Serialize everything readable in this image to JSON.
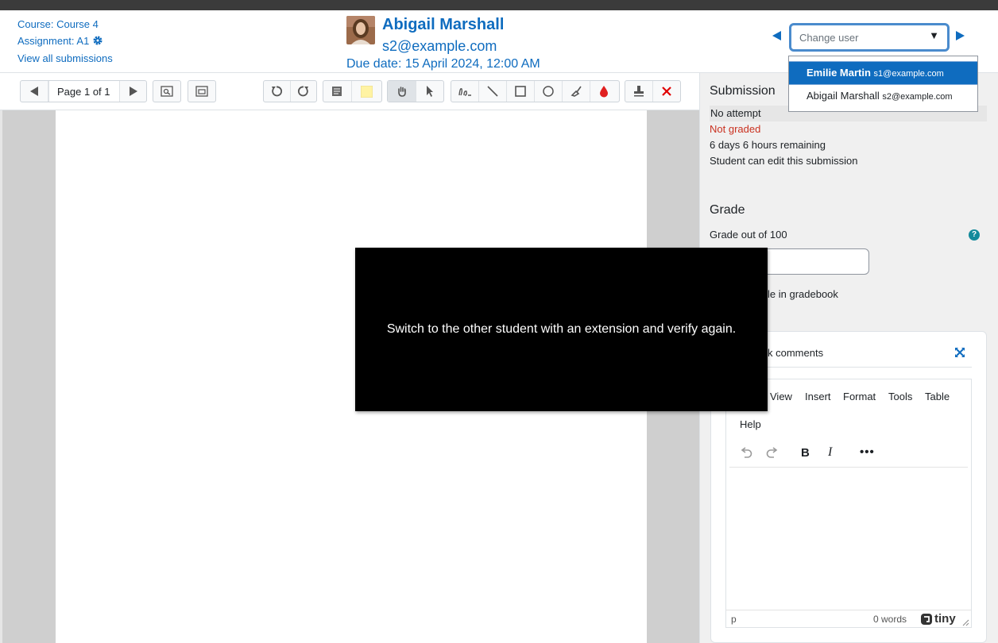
{
  "header": {
    "course": "Course: Course 4",
    "assignment": "Assignment: A1",
    "view_all": "View all submissions",
    "user_name": "Abigail Marshall",
    "user_email": "s2@example.com",
    "due_date": "Due date: 15 April 2024, 12:00 AM"
  },
  "user_switcher": {
    "placeholder": "Change user",
    "options": [
      {
        "name": "Emilie Martin",
        "email": "s1@example.com",
        "selected": true
      },
      {
        "name": "Abigail Marshall",
        "email": "s2@example.com",
        "selected": false
      }
    ]
  },
  "toolbar": {
    "page_label": "Page 1 of 1",
    "icons": [
      "prev-page-icon",
      "next-page-icon",
      "search-comments-icon",
      "expand-view-icon",
      "rotate-left-icon",
      "rotate-right-icon",
      "comment-icon",
      "comment-color-icon",
      "pan-icon",
      "select-icon",
      "pen-icon",
      "line-icon",
      "rectangle-icon",
      "oval-icon",
      "highlight-icon",
      "color-icon",
      "stamp-icon",
      "delete-icon"
    ],
    "colors": {
      "comment_yellow": "#fff3a3",
      "delete_red": "#e00000",
      "ink_red": "#e02020"
    }
  },
  "submission": {
    "title": "Submission",
    "status": "No attempt",
    "grading": "Not graded",
    "remaining": "6 days 6 hours remaining",
    "editable": "Student can edit this submission"
  },
  "grade": {
    "title": "Grade",
    "label": "Grade out of 100",
    "gradebook_text": "le in gradebook"
  },
  "feedback": {
    "title": "k comments",
    "menu": [
      "View",
      "Insert",
      "Format",
      "Tools",
      "Table",
      "Help"
    ],
    "status_path": "p",
    "word_count": "0 words",
    "brand": "tiny"
  },
  "overlay": {
    "message": "Switch to the other student with an extension and verify again."
  },
  "colors": {
    "link": "#0f6cbf",
    "danger": "#ca3120",
    "selected": "#0f6cbf"
  }
}
